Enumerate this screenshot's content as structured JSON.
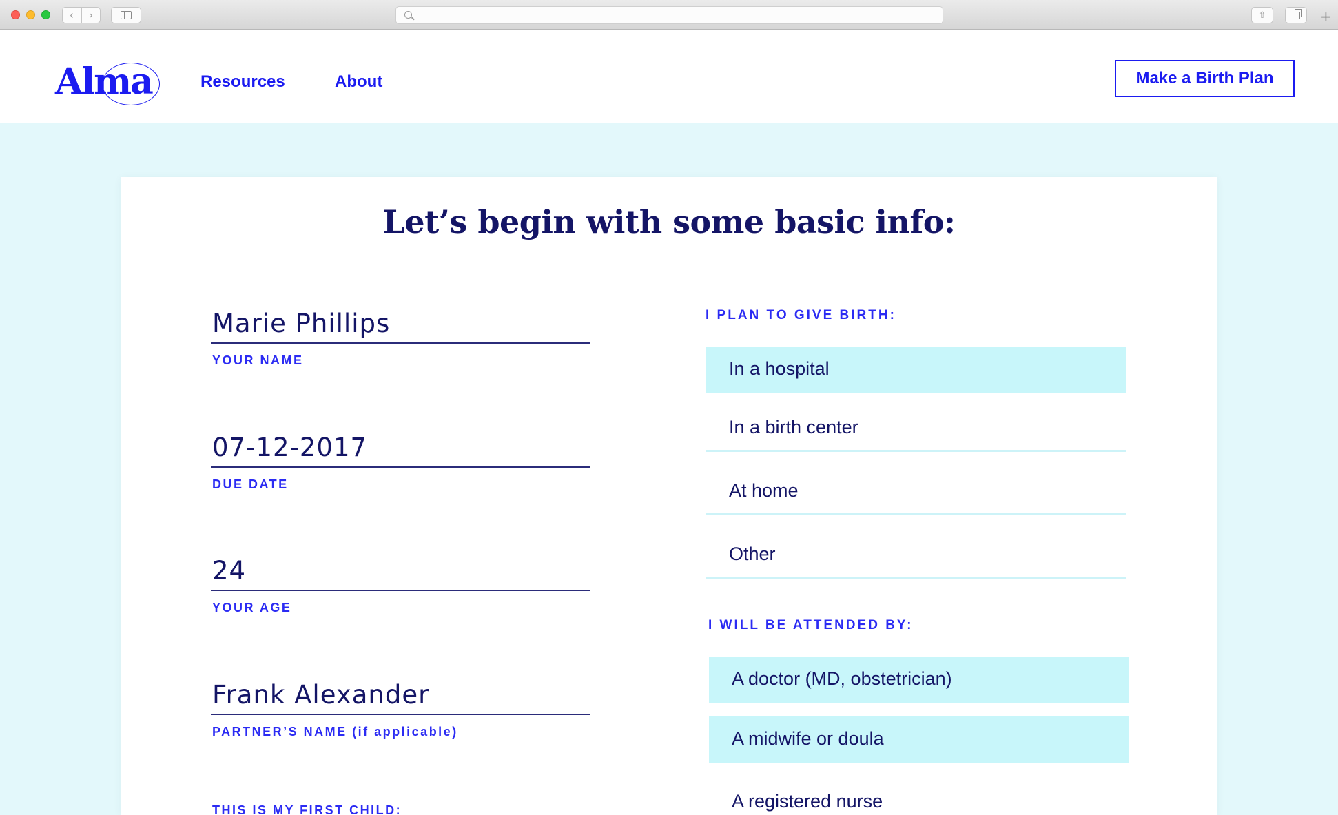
{
  "browser": {
    "icons": {
      "back": "chevron-left-icon",
      "forward": "chevron-right-icon",
      "sidebar": "sidebar-icon",
      "search": "search-icon",
      "share": "share-icon",
      "tabs": "tabs-icon",
      "new_tab": "plus-icon"
    }
  },
  "header": {
    "logo_text": "Alma",
    "nav": [
      {
        "label": "Resources"
      },
      {
        "label": "About"
      }
    ],
    "cta_label": "Make a Birth Plan"
  },
  "form": {
    "title": "Let’s begin with some basic info:",
    "fields": {
      "name": {
        "value": "Marie Phillips",
        "label": "YOUR NAME"
      },
      "due": {
        "value": "07-12-2017",
        "label": "DUE DATE"
      },
      "age": {
        "value": "24",
        "label": "YOUR AGE"
      },
      "partner": {
        "value": "Frank Alexander",
        "label": "PARTNER’S NAME (if applicable)"
      },
      "first_child": {
        "label": "THIS IS MY FIRST CHILD:"
      }
    },
    "birth_place": {
      "label": "I PLAN TO GIVE BIRTH:",
      "options": [
        {
          "label": "In a hospital",
          "selected": true
        },
        {
          "label": "In a birth center",
          "selected": false
        },
        {
          "label": "At home",
          "selected": false
        },
        {
          "label": "Other",
          "selected": false
        }
      ]
    },
    "attended_by": {
      "label": "I WILL BE ATTENDED BY:",
      "options": [
        {
          "label": "A doctor (MD, obstetrician)",
          "selected": true
        },
        {
          "label": "A midwife or doula",
          "selected": true
        },
        {
          "label": "A registered nurse",
          "selected": false
        }
      ]
    }
  },
  "colors": {
    "brand_blue": "#1b1bf0",
    "navy_text": "#141566",
    "page_bg": "#e3f8fb",
    "selected_option": "#c8f6fa"
  }
}
